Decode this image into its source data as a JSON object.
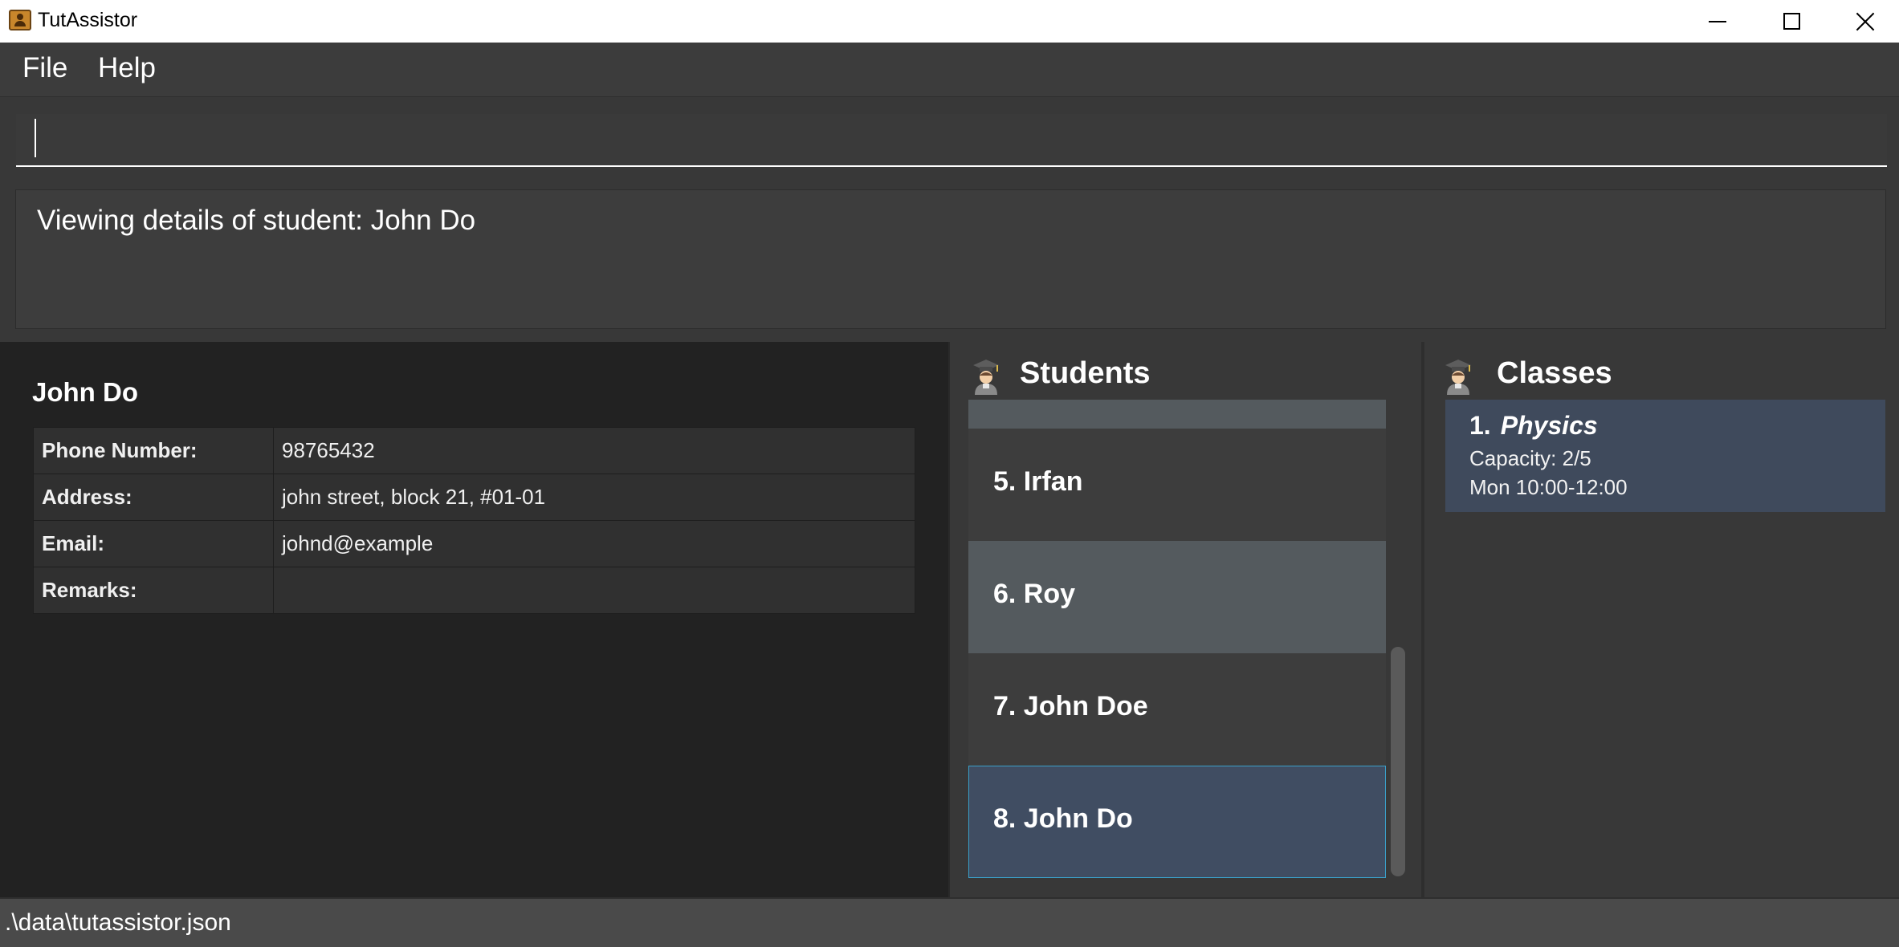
{
  "window": {
    "title": "TutAssistor"
  },
  "menu": {
    "file": "File",
    "help": "Help"
  },
  "command": {
    "value": ""
  },
  "result": {
    "message": "Viewing details of student: John Do"
  },
  "details": {
    "name": "John Do",
    "rows": [
      {
        "label": "Phone Number:",
        "value": "98765432"
      },
      {
        "label": "Address:",
        "value": "john street, block 21, #01-01"
      },
      {
        "label": "Email:",
        "value": "johnd@example"
      },
      {
        "label": "Remarks:",
        "value": ""
      }
    ]
  },
  "students": {
    "title": "Students",
    "items": [
      {
        "label": "5.  Irfan",
        "color": "#3d3d3d"
      },
      {
        "label": "6.  Roy",
        "color": "#545a5e"
      },
      {
        "label": "7.  John Doe",
        "color": "#3d3d3d"
      },
      {
        "label": "8.  John Do",
        "color": "#404d62",
        "selected": true
      }
    ],
    "partial_item_color": "#545a5e"
  },
  "classes": {
    "title": "Classes",
    "items": [
      {
        "index": "1.",
        "name": "Physics",
        "capacity": "Capacity: 2/5",
        "schedule": "Mon 10:00-12:00"
      }
    ]
  },
  "status": {
    "path": ".\\data\\tutassistor.json"
  },
  "icons": {
    "app": "address-book-icon",
    "students": "graduate-icon",
    "classes": "graduate-icon"
  }
}
